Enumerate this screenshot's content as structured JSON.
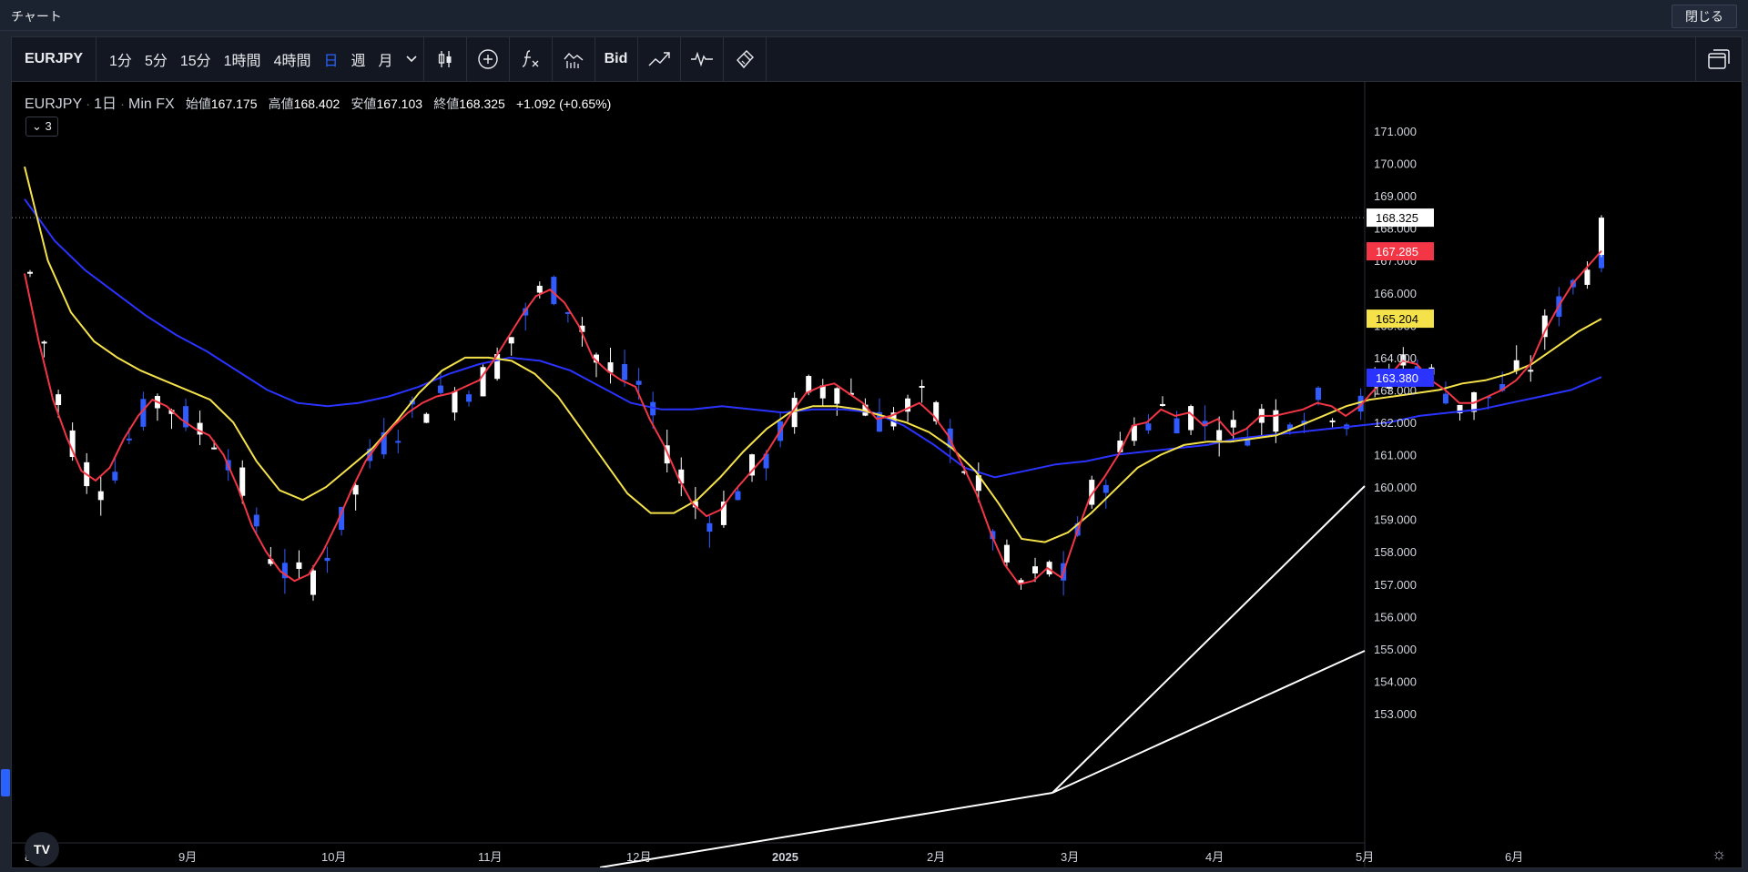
{
  "window": {
    "title": "チャート",
    "close_label": "閉じる"
  },
  "toolbar": {
    "symbol": "EURJPY",
    "intervals": [
      "1分",
      "5分",
      "15分",
      "1時間",
      "4時間",
      "日",
      "週",
      "月"
    ],
    "active_interval": "日",
    "bid_label": "Bid"
  },
  "legend": {
    "symbol": "EURJPY",
    "interval": "1日",
    "source": "Min FX",
    "open_label": "始値",
    "open": "167.175",
    "high_label": "高値",
    "high": "168.402",
    "low_label": "安値",
    "low": "167.103",
    "close_label": "終値",
    "close": "168.325",
    "change": "+1.092 (+0.65%)",
    "indicators_count": "3"
  },
  "colors": {
    "up_candle": "#ffffff",
    "down_candle": "#2f5bff",
    "ma_fast": "#f23645",
    "ma_mid": "#f5e24a",
    "ma_slow": "#2a33ff",
    "price_tag": "#ffffff"
  },
  "chart_data": {
    "type": "candlestick",
    "title": "",
    "ylim": [
      152.9,
      171.5
    ],
    "y_ticks": [
      "171.000",
      "170.000",
      "169.000",
      "168.000",
      "167.000",
      "166.000",
      "165.000",
      "164.000",
      "163.000",
      "162.000",
      "161.000",
      "160.000",
      "159.000",
      "158.000",
      "157.000",
      "156.000",
      "155.000",
      "154.000",
      "153.000"
    ],
    "x_ticks": [
      "8月",
      "9月",
      "10月",
      "11月",
      "12月",
      "2025",
      "2月",
      "3月",
      "4月",
      "5月",
      "6月"
    ],
    "price_tags": [
      {
        "value": "168.325",
        "series": "last"
      },
      {
        "value": "167.285",
        "series": "ma_fast"
      },
      {
        "value": "165.204",
        "series": "ma_mid"
      },
      {
        "value": "163.380",
        "series": "ma_slow"
      }
    ],
    "ma_fast": [
      166.6,
      164.5,
      162.7,
      161.5,
      160.5,
      160.2,
      160.6,
      161.5,
      162.2,
      162.7,
      162.5,
      162.1,
      161.8,
      161.6,
      161.0,
      160.0,
      158.8,
      158.0,
      157.4,
      157.1,
      157.3,
      158.0,
      158.9,
      159.9,
      160.8,
      161.4,
      161.9,
      162.3,
      162.6,
      162.8,
      162.9,
      163.1,
      163.3,
      163.9,
      164.6,
      165.3,
      165.9,
      166.1,
      165.7,
      165.0,
      164.0,
      163.6,
      163.3,
      163.1,
      162.1,
      161.3,
      160.3,
      159.5,
      159.1,
      159.3,
      159.9,
      160.4,
      160.9,
      161.6,
      162.3,
      162.9,
      163.1,
      163.2,
      162.9,
      162.6,
      162.1,
      162.2,
      162.4,
      162.6,
      162.2,
      161.6,
      160.7,
      159.8,
      158.6,
      157.6,
      157.0,
      157.1,
      157.5,
      157.2,
      158.5,
      159.7,
      160.3,
      161.0,
      161.9,
      162.0,
      162.4,
      162.2,
      162.3,
      161.9,
      162.1,
      161.6,
      161.8,
      162.2,
      162.2,
      162.3,
      162.4,
      162.6,
      162.5,
      162.2,
      162.5,
      163.0,
      163.4,
      163.9,
      163.8,
      163.3,
      163.0,
      162.6,
      162.6,
      162.8,
      163.0,
      163.3,
      163.8,
      164.8,
      165.6,
      166.3,
      166.8,
      167.3
    ],
    "ma_mid": [
      169.9,
      167.0,
      165.4,
      164.5,
      164.0,
      163.6,
      163.3,
      163.0,
      162.7,
      162.0,
      160.8,
      159.9,
      159.6,
      160.0,
      160.6,
      161.2,
      162.0,
      162.9,
      163.6,
      164.0,
      164.0,
      163.9,
      163.5,
      162.8,
      161.8,
      160.8,
      159.8,
      159.2,
      159.2,
      159.6,
      160.3,
      161.1,
      161.8,
      162.3,
      162.5,
      162.5,
      162.4,
      162.2,
      162.0,
      161.7,
      161.2,
      160.5,
      159.5,
      158.4,
      158.3,
      158.6,
      159.2,
      159.9,
      160.6,
      161.0,
      161.3,
      161.4,
      161.4,
      161.5,
      161.6,
      161.9,
      162.2,
      162.5,
      162.7,
      162.8,
      162.9,
      163.0,
      163.2,
      163.3,
      163.5,
      163.8,
      164.3,
      164.8,
      165.2
    ],
    "ma_slow": [
      168.9,
      167.6,
      166.7,
      166.0,
      165.3,
      164.7,
      164.2,
      163.6,
      163.0,
      162.6,
      162.5,
      162.6,
      162.8,
      163.1,
      163.5,
      163.8,
      164.0,
      163.9,
      163.6,
      163.1,
      162.6,
      162.4,
      162.4,
      162.5,
      162.4,
      162.3,
      162.4,
      162.4,
      162.3,
      161.9,
      161.3,
      160.6,
      160.3,
      160.5,
      160.7,
      160.8,
      161.0,
      161.1,
      161.2,
      161.3,
      161.5,
      161.6,
      161.7,
      161.8,
      161.9,
      162.0,
      162.2,
      162.3,
      162.4,
      162.6,
      162.8,
      163.0,
      163.4
    ]
  }
}
